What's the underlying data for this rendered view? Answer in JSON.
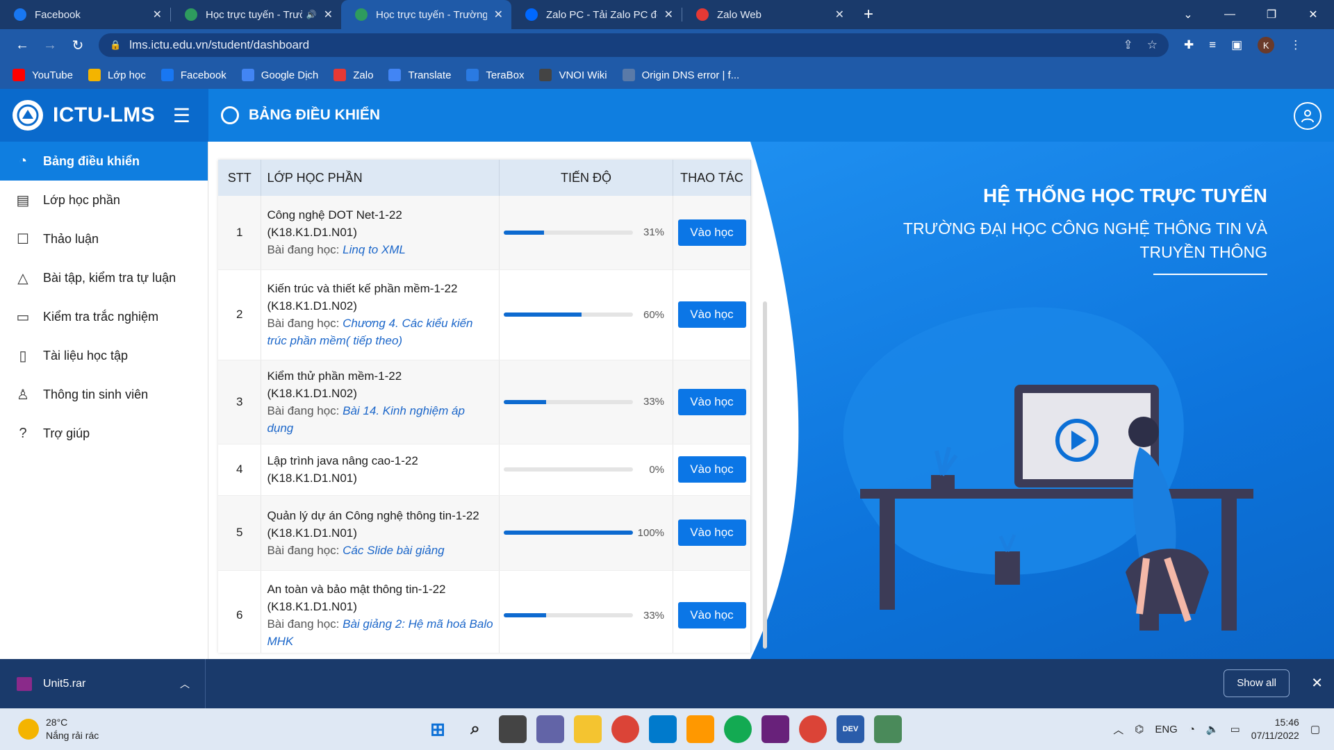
{
  "browser": {
    "tabs": [
      {
        "title": "Facebook",
        "icon": "facebook-icon",
        "color": "#1877f2"
      },
      {
        "title": "Học trực tuyến - Trường Đại",
        "icon": "ictu-icon",
        "color": "#2e9b5e",
        "muted": "🔊"
      },
      {
        "title": "Học trực tuyến - Trường Đại học",
        "icon": "ictu-icon",
        "color": "#2e9b5e",
        "active": true
      },
      {
        "title": "Zalo PC - Tải Zalo PC để làm việc",
        "icon": "zalo-icon",
        "color": "#0068ff"
      },
      {
        "title": "Zalo Web",
        "icon": "zalo-icon",
        "color": "#e53935"
      }
    ],
    "url": "lms.ictu.edu.vn/student/dashboard",
    "profile_initial": "K",
    "bookmarks": [
      {
        "label": "YouTube",
        "color": "#ff0000"
      },
      {
        "label": "Lớp học",
        "color": "#f4b400"
      },
      {
        "label": "Facebook",
        "color": "#1877f2"
      },
      {
        "label": "Google Dịch",
        "color": "#4285f4"
      },
      {
        "label": "Zalo",
        "color": "#e53935"
      },
      {
        "label": "Translate",
        "color": "#4285f4"
      },
      {
        "label": "TeraBox",
        "color": "#2a7ae2"
      },
      {
        "label": "VNOI Wiki",
        "color": "#444444"
      },
      {
        "label": "Origin DNS error | f...",
        "color": "#5a7aa8"
      }
    ]
  },
  "app": {
    "brand": "ICTU-LMS",
    "page_title": "BẢNG ĐIỀU KHIỂN",
    "sidebar": [
      {
        "label": "Bảng điều khiển",
        "icon": "dashboard-icon",
        "active": true
      },
      {
        "label": "Lớp học phần",
        "icon": "briefcase-icon"
      },
      {
        "label": "Thảo luận",
        "icon": "discussion-icon"
      },
      {
        "label": "Bài tập, kiểm tra tự luận",
        "icon": "shapes-icon"
      },
      {
        "label": "Kiểm tra trắc nghiệm",
        "icon": "monitor-icon"
      },
      {
        "label": "Tài liệu học tập",
        "icon": "book-icon"
      },
      {
        "label": "Thông tin sinh viên",
        "icon": "user-icon"
      },
      {
        "label": "Trợ giúp",
        "icon": "help-icon"
      }
    ],
    "table": {
      "headers": [
        "STT",
        "LỚP HỌC PHẦN",
        "TIẾN ĐỘ",
        "THAO TÁC"
      ],
      "lesson_prefix": "Bài đang học: ",
      "rows": [
        {
          "stt": "1",
          "name": "Công nghệ DOT Net-1-22 (K18.K1.D1.N01)",
          "lesson": "Linq to XML",
          "progress": 31,
          "pct": "31%",
          "action": "Vào học"
        },
        {
          "stt": "2",
          "name": "Kiến trúc và thiết kế phần mềm-1-22 (K18.K1.D1.N02)",
          "lesson": "Chương 4. Các kiểu kiến trúc phần mềm( tiếp theo)",
          "progress": 60,
          "pct": "60%",
          "action": "Vào học"
        },
        {
          "stt": "3",
          "name": "Kiểm thử phần mềm-1-22 (K18.K1.D1.N02)",
          "lesson": "Bài 14. Kinh nghiệm áp dụng",
          "progress": 33,
          "pct": "33%",
          "action": "Vào học"
        },
        {
          "stt": "4",
          "name": "Lập trình java nâng cao-1-22 (K18.K1.D1.N01)",
          "lesson": "",
          "progress": 0,
          "pct": "0%",
          "action": "Vào học"
        },
        {
          "stt": "5",
          "name": "Quản lý dự án Công nghệ thông tin-1-22 (K18.K1.D1.N01)",
          "lesson": "Các Slide bài giảng",
          "progress": 100,
          "pct": "100%",
          "action": "Vào học"
        },
        {
          "stt": "6",
          "name": "An toàn và bảo mật thông tin-1-22 (K18.K1.D1.N01)",
          "lesson": "Bài giảng 2: Hệ mã hoá Balo MHK",
          "progress": 33,
          "pct": "33%",
          "action": "Vào học"
        }
      ]
    },
    "hero": {
      "title": "HỆ THỐNG HỌC TRỰC TUYẾN",
      "subtitle_1": "TRƯỜNG ĐẠI HỌC CÔNG NGHỆ THÔNG TIN VÀ",
      "subtitle_2": "TRUYỀN THÔNG"
    }
  },
  "downloads": {
    "file": "Unit5.rar",
    "show_all": "Show all"
  },
  "taskbar": {
    "temp": "28°C",
    "weather": "Nắng rải rác",
    "lang": "ENG",
    "time": "15:46",
    "date": "07/11/2022"
  }
}
